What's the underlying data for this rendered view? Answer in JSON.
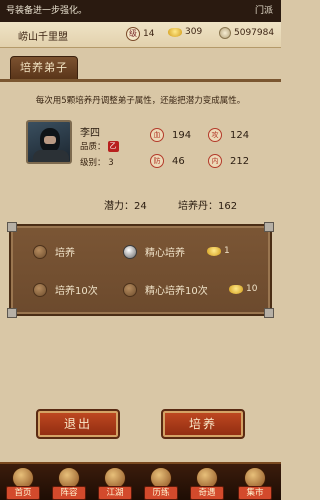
{
  "notice": {
    "text": "号装备进一步强化。",
    "right": "门派"
  },
  "header": {
    "region": "崂山千里盟",
    "rank_icon": "级",
    "rank": "14",
    "gold": "309",
    "silver": "5097984"
  },
  "title": "培养弟子",
  "description": "每次用5颗培养丹调整弟子属性，还能把潜力变成属性。",
  "disciple": {
    "name": "李四",
    "quality_label": "品质：",
    "quality_badge": "乙",
    "level_label": "级别：",
    "level": "3"
  },
  "attributes": [
    {
      "icon": "血",
      "value": "194"
    },
    {
      "icon": "攻",
      "value": "124"
    },
    {
      "icon": "防",
      "value": "46"
    },
    {
      "icon": "内",
      "value": "212"
    }
  ],
  "potential_label": "潜力：",
  "potential": "24",
  "pill_label": "培养丹：",
  "pill": "162",
  "options": {
    "normal": "培养",
    "careful": "精心培养",
    "careful_cost": "1",
    "normal10": "培养10次",
    "careful10": "精心培养10次",
    "careful10_cost": "10",
    "selected": "careful"
  },
  "buttons": {
    "exit": "退出",
    "train": "培养"
  },
  "nav": [
    "首页",
    "阵容",
    "江湖",
    "历练",
    "奇遇",
    "集市"
  ]
}
